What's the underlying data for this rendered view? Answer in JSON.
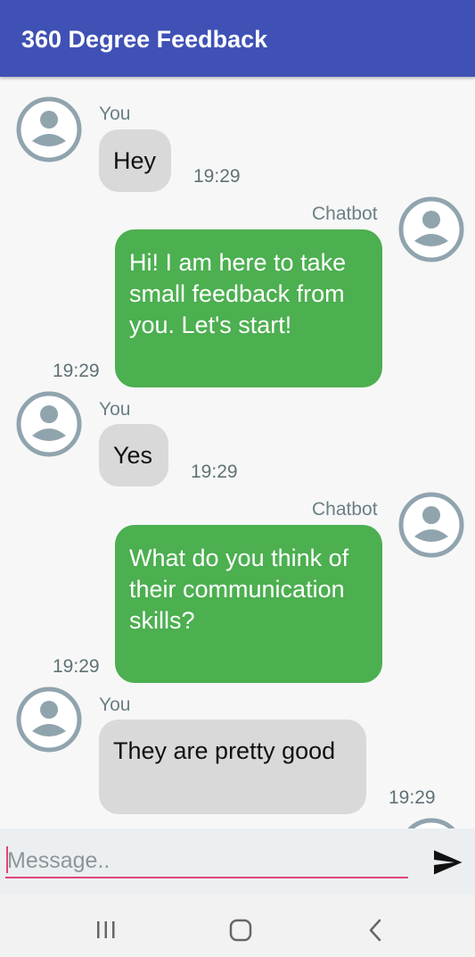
{
  "app": {
    "title": "360 Degree Feedback"
  },
  "messages": [
    {
      "sender": "You",
      "text": "Hey",
      "time": "19:29"
    },
    {
      "sender": "Chatbot",
      "text": "Hi! I am here to take small feedback from you. Let's start!",
      "time": "19:29"
    },
    {
      "sender": "You",
      "text": "Yes",
      "time": "19:29"
    },
    {
      "sender": "Chatbot",
      "text": "What do you think of their communication skills?",
      "time": "19:29"
    },
    {
      "sender": "You",
      "text": "They are pretty good",
      "time": "19:29"
    }
  ],
  "input": {
    "placeholder": "Message..",
    "value": ""
  },
  "icons": {
    "avatar": "user-avatar-icon",
    "send": "send-icon",
    "recents": "recents-icon",
    "home": "home-icon",
    "back": "back-icon"
  },
  "colors": {
    "appbar": "#3f51b5",
    "bot_bubble": "#4caf50",
    "user_bubble": "#d9d9d9",
    "input_underline": "#e0447a",
    "avatar": "#90a4ae"
  }
}
